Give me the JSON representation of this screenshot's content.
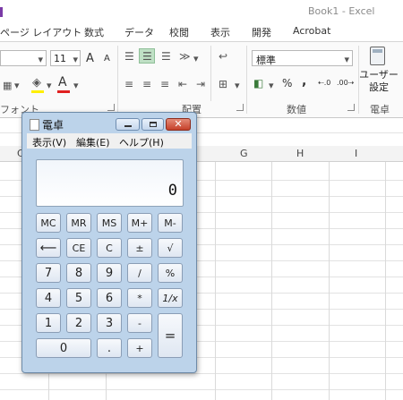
{
  "excel": {
    "window_title": "Book1 - Excel",
    "ribbon_tabs": [
      "ページ レイアウト",
      "数式",
      "データ",
      "校閲",
      "表示",
      "開発",
      "Acrobat"
    ],
    "font_size": "11",
    "font_grow": "A",
    "font_shrink": "A",
    "font_color_letter": "A",
    "number_format": "標準",
    "percent": "%",
    "comma": ",",
    "user_settings_label": "ユーザー\n設定",
    "groups": {
      "font": "フォント",
      "alignment": "配置",
      "number": "数値",
      "calc": "電卓"
    },
    "columns": [
      "C",
      "G",
      "H",
      "I"
    ]
  },
  "calculator": {
    "title": "電卓",
    "menu": [
      "表示(V)",
      "編集(E)",
      "ヘルプ(H)"
    ],
    "display": "0",
    "keys": {
      "mc": "MC",
      "mr": "MR",
      "ms": "MS",
      "mplus": "M+",
      "mminus": "M-",
      "back": "⟵",
      "ce": "CE",
      "c": "C",
      "plusminus": "±",
      "sqrt": "√",
      "n7": "7",
      "n8": "8",
      "n9": "9",
      "div": "/",
      "pct": "%",
      "n4": "4",
      "n5": "5",
      "n6": "6",
      "mul": "*",
      "recip": "1/x",
      "n1": "1",
      "n2": "2",
      "n3": "3",
      "sub": "-",
      "eq": "=",
      "n0": "0",
      "dot": ".",
      "add": "+"
    }
  }
}
